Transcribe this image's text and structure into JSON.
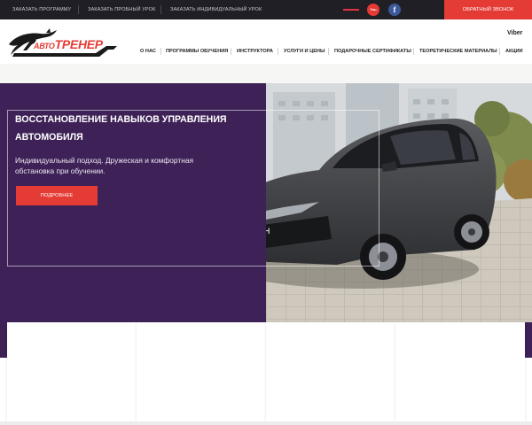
{
  "topbar": {
    "links": [
      "ЗАКАЗАТЬ ПРОГРАММУ",
      "ЗАКАЗАТЬ ПРОБНЫЙ УРОК",
      "ЗАКАЗАТЬ ИНДИВИДУАЛЬНЫЙ УРОК"
    ],
    "youtube_icon": "youtube-icon",
    "youtube_glyph": "You Tube",
    "facebook_icon": "facebook-icon",
    "facebook_glyph": "f",
    "callback_label": "ОБРАТНЫЙ ЗВОНОК",
    "colors": {
      "background": "#1f1f25",
      "accent": "#e53b35"
    }
  },
  "header": {
    "logo": {
      "small": "АВТО",
      "large": "ТРЕНЕР",
      "icon": "panther-logo"
    },
    "viber_label": "Viber",
    "nav": [
      "О НАС",
      "ПРОГРАММЫ ОБУЧЕНИЯ",
      "ИНСТРУКТОРА",
      "УСЛУГИ И ЦЕНЫ",
      "ПОДАРОЧНЫЕ СЕРТИФИКАТЫ",
      "ТЕОРЕТИЧЕСКИЕ МАТЕРИАЛЫ",
      "АКЦИИ"
    ]
  },
  "hero": {
    "title": "ВОССТАНОВЛЕНИЕ НАВЫКОВ УПРАВЛЕНИЯ АВТОМОБИЛЯ",
    "subtitle": "Индивидуальный подход. Дружеская и комфортная обстановка при обучении.",
    "button_label": "ПОДРОБНЕЕ",
    "image": "dark-grey-sedan-photo",
    "colors": {
      "panel": "#3e2257",
      "button": "#e53b35"
    }
  },
  "cards": {
    "count": 4
  }
}
